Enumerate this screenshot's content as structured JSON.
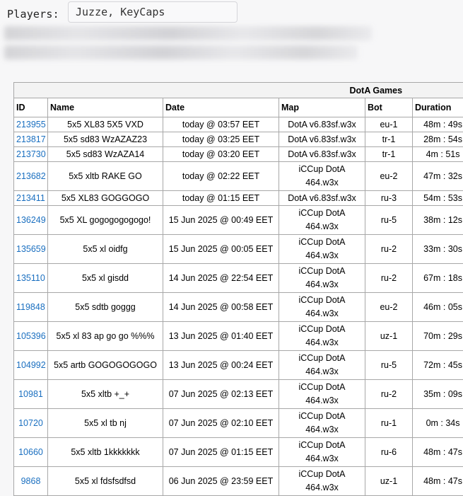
{
  "players": {
    "label": "Players:",
    "value": "Juzze, KeyCaps"
  },
  "table": {
    "title": "DotA Games",
    "headers": {
      "id": "ID",
      "name": "Name",
      "date": "Date",
      "map": "Map",
      "bot": "Bot",
      "duration": "Duration"
    },
    "rows": [
      {
        "id": "213955",
        "name": "5x5 XL83 5X5 VXD",
        "date": "today @ 03:57 EET",
        "map": "DotA v6.83sf.w3x",
        "bot": "eu-1",
        "duration": "48m : 49s"
      },
      {
        "id": "213817",
        "name": "5x5 sd83 WzAZAZ23",
        "date": "today @ 03:25 EET",
        "map": "DotA v6.83sf.w3x",
        "bot": "tr-1",
        "duration": "28m : 54s"
      },
      {
        "id": "213730",
        "name": "5x5 sd83 WzAZA14",
        "date": "today @ 03:20 EET",
        "map": "DotA v6.83sf.w3x",
        "bot": "tr-1",
        "duration": "4m : 51s"
      },
      {
        "id": "213682",
        "name": "5x5 xltb RAKE GO",
        "date": "today @ 02:22 EET",
        "map1": "iCCup DotA",
        "map2": "464.w3x",
        "bot": "eu-2",
        "duration": "47m : 32s"
      },
      {
        "id": "213411",
        "name": "5x5 XL83 GOGGOGO",
        "date": "today @ 01:15 EET",
        "map": "DotA v6.83sf.w3x",
        "bot": "ru-3",
        "duration": "54m : 53s"
      },
      {
        "id": "136249",
        "name": "5x5 XL gogogogogogo!",
        "date": "15 Jun 2025 @ 00:49 EET",
        "map1": "iCCup DotA",
        "map2": "464.w3x",
        "bot": "ru-5",
        "duration": "38m : 12s"
      },
      {
        "id": "135659",
        "name": "5x5 xl oidfg",
        "date": "15 Jun 2025 @ 00:05 EET",
        "map1": "iCCup DotA",
        "map2": "464.w3x",
        "bot": "ru-2",
        "duration": "33m : 30s"
      },
      {
        "id": "135110",
        "name": "5x5 xl gisdd",
        "date": "14 Jun 2025 @ 22:54 EET",
        "map1": "iCCup DotA",
        "map2": "464.w3x",
        "bot": "ru-2",
        "duration": "67m : 18s"
      },
      {
        "id": "119848",
        "name": "5x5 sdtb goggg",
        "date": "14 Jun 2025 @ 00:58 EET",
        "map1": "iCCup DotA",
        "map2": "464.w3x",
        "bot": "eu-2",
        "duration": "46m : 05s"
      },
      {
        "id": "105396",
        "name": "5x5 xl 83 ap go go %%%",
        "date": "13 Jun 2025 @ 01:40 EET",
        "map1": "iCCup DotA",
        "map2": "464.w3x",
        "bot": "uz-1",
        "duration": "70m : 29s"
      },
      {
        "id": "104992",
        "name": "5x5 artb GOGOGOGOGO",
        "date": "13 Jun 2025 @ 00:24 EET",
        "map1": "iCCup DotA",
        "map2": "464.w3x",
        "bot": "ru-5",
        "duration": "72m : 45s"
      },
      {
        "id": "10981",
        "name": "5x5 xltb +_+",
        "date": "07 Jun 2025 @ 02:13 EET",
        "map1": "iCCup DotA",
        "map2": "464.w3x",
        "bot": "ru-2",
        "duration": "35m : 09s"
      },
      {
        "id": "10720",
        "name": "5x5 xl tb nj",
        "date": "07 Jun 2025 @ 02:10 EET",
        "map1": "iCCup DotA",
        "map2": "464.w3x",
        "bot": "ru-1",
        "duration": "0m : 34s"
      },
      {
        "id": "10660",
        "name": "5x5 xltb 1kkkkkkk",
        "date": "07 Jun 2025 @ 01:15 EET",
        "map1": "iCCup DotA",
        "map2": "464.w3x",
        "bot": "ru-6",
        "duration": "48m : 47s"
      },
      {
        "id": "9868",
        "name": "5x5 xl fdsfsdfsd",
        "date": "06 Jun 2025 @ 23:59 EET",
        "map1": "iCCup DotA",
        "map2": "464.w3x",
        "bot": "uz-1",
        "duration": "48m : 47s"
      }
    ]
  }
}
